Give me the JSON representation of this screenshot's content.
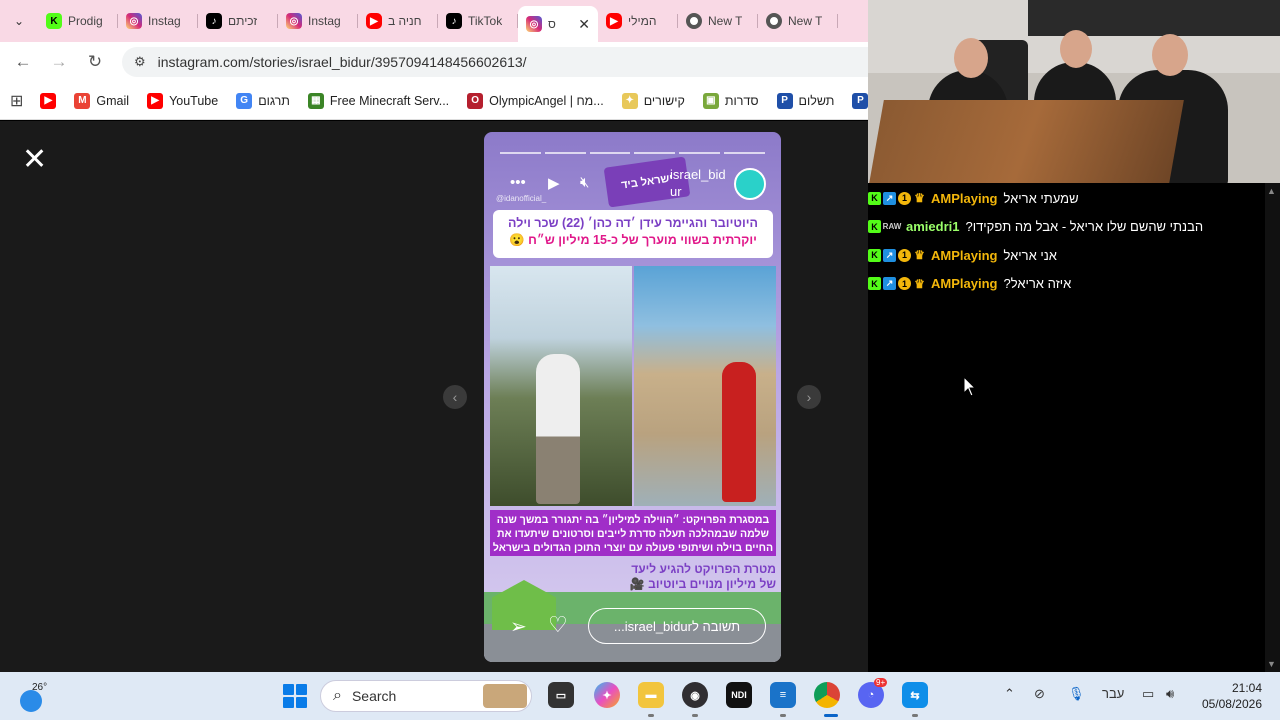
{
  "tabs": [
    {
      "label": "Prodig",
      "icon": "kick-icon",
      "iconClass": "kick",
      "glyph": "K"
    },
    {
      "label": "Instag",
      "icon": "instagram-icon",
      "iconClass": "ig",
      "glyph": "◎"
    },
    {
      "label": "זכיתם",
      "icon": "tiktok-icon",
      "iconClass": "tt",
      "glyph": "♪"
    },
    {
      "label": "Instag",
      "icon": "instagram-icon",
      "iconClass": "ig",
      "glyph": "◎"
    },
    {
      "label": "חניה ב",
      "icon": "youtube-icon",
      "iconClass": "yt",
      "glyph": "▶"
    },
    {
      "label": "TikTok",
      "icon": "tiktok-icon",
      "iconClass": "tt",
      "glyph": "♪"
    },
    {
      "label": "ס",
      "icon": "instagram-icon",
      "iconClass": "ig",
      "glyph": "◎",
      "active": true
    },
    {
      "label": "המילי",
      "icon": "youtube-icon",
      "iconClass": "yt",
      "glyph": "▶"
    },
    {
      "label": "New T",
      "icon": "chrome-icon",
      "iconClass": "gh",
      "glyph": ""
    },
    {
      "label": "New T",
      "icon": "chrome-icon",
      "iconClass": "gh",
      "glyph": ""
    }
  ],
  "address": {
    "url": "instagram.com/stories/israel_bidur/3957094148456602613/"
  },
  "bookmarks": [
    {
      "label": "",
      "icon": "youtube-icon",
      "color": "#ff0000",
      "glyph": "▶"
    },
    {
      "label": "Gmail",
      "icon": "gmail-icon",
      "color": "#ea4335",
      "glyph": "M"
    },
    {
      "label": "YouTube",
      "icon": "youtube-icon",
      "color": "#ff0000",
      "glyph": "▶"
    },
    {
      "label": "תרגום",
      "icon": "translate-icon",
      "color": "#4285f4",
      "glyph": "G"
    },
    {
      "label": "Free Minecraft Serv...",
      "icon": "minecraft-icon",
      "color": "#3b8526",
      "glyph": "▦"
    },
    {
      "label": "OlympicAngel | מח...",
      "icon": "olympicangel-icon",
      "color": "#b51f2e",
      "glyph": "O"
    },
    {
      "label": "קישורים",
      "icon": "folder-icon",
      "color": "#e8c85a",
      "glyph": "✦"
    },
    {
      "label": "סדרות",
      "icon": "series-icon",
      "color": "#7aa83b",
      "glyph": "▣"
    },
    {
      "label": "תשלום",
      "icon": "paypal-icon",
      "color": "#1f4fa8",
      "glyph": "P"
    },
    {
      "label": "",
      "icon": "paypal-icon",
      "color": "#1f4fa8",
      "glyph": "P"
    }
  ],
  "story": {
    "username": "israel_bidur",
    "handle": "@idanofficial_",
    "headline_line1": "היוטיובר והגיימר עידן ׳דה כהן׳ (22) שכר וילה",
    "headline_line2": "יוקרתית בשווי מוערך של כ-15 מיליון ש״ח 😮",
    "desc_line1": "במסגרת הפרויקט: ״הווילה למיליון״ בה יתגורר במשך שנה",
    "desc_line2": "שלמה שבמהלכה תעלה סדרת לייבים וסרטונים שיתעדו את",
    "desc_line3": "החיים בוילה ושיתופי פעולה עם יוצרי התוכן הגדולים בישראל",
    "goal_line1": "מטרת הפרויקט להגיע ליעד",
    "goal_line2": "של מיליון מנויים ביוטיוב 🎥",
    "reply_placeholder": "תשובה לisrael_bidur..."
  },
  "chat": [
    {
      "user": "AMPlaying",
      "text": "שמעתי אריאל",
      "color": "gold"
    },
    {
      "user": "amiedri1",
      "text": "הבנתי שהשם שלו אריאל - אבל מה תפקידו?",
      "color": "green"
    },
    {
      "user": "AMPlaying",
      "text": "אני אריאל",
      "color": "gold"
    },
    {
      "user": "AMPlaying",
      "text": "איזה אריאל?",
      "color": "gold"
    }
  ],
  "taskbar": {
    "weather_temp": "26°",
    "search_label": "Search",
    "language": "עבר",
    "time": "21:04",
    "date": "05/08/2026",
    "discord_badge": "9+"
  },
  "colors": {
    "tabbar": "#f9d9e5",
    "chat_gold": "#f3b70b",
    "chat_green": "#9bff6a",
    "accent": "#7b3fc4"
  }
}
